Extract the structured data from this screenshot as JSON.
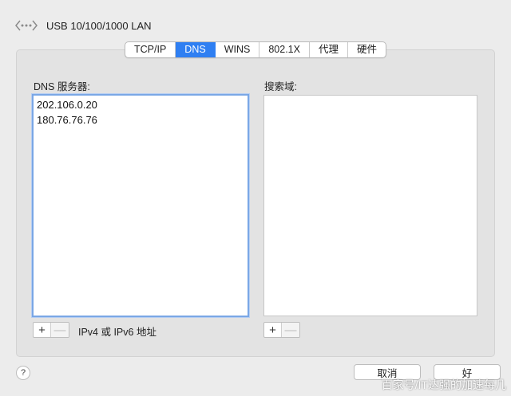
{
  "header": {
    "title": "USB 10/100/1000 LAN",
    "icon": "network-icon"
  },
  "tabs": [
    {
      "label": "TCP/IP",
      "active": false
    },
    {
      "label": "DNS",
      "active": true
    },
    {
      "label": "WINS",
      "active": false
    },
    {
      "label": "802.1X",
      "active": false
    },
    {
      "label": "代理",
      "active": false
    },
    {
      "label": "硬件",
      "active": false
    }
  ],
  "dns": {
    "label": "DNS 服务器:",
    "servers": [
      "202.106.0.20",
      "180.76.76.76"
    ],
    "hint": "IPv4 或 IPv6 地址"
  },
  "search_domains": {
    "label": "搜索域:",
    "items": []
  },
  "controls": {
    "add": "+",
    "remove": "—",
    "help": "?"
  },
  "footer": {
    "cancel_label": "取消",
    "ok_label": "好"
  },
  "watermark": "百家号/IT达强的加速每几",
  "colors": {
    "accent": "#2f7ff2",
    "focus_ring": "#7aa7e6"
  }
}
